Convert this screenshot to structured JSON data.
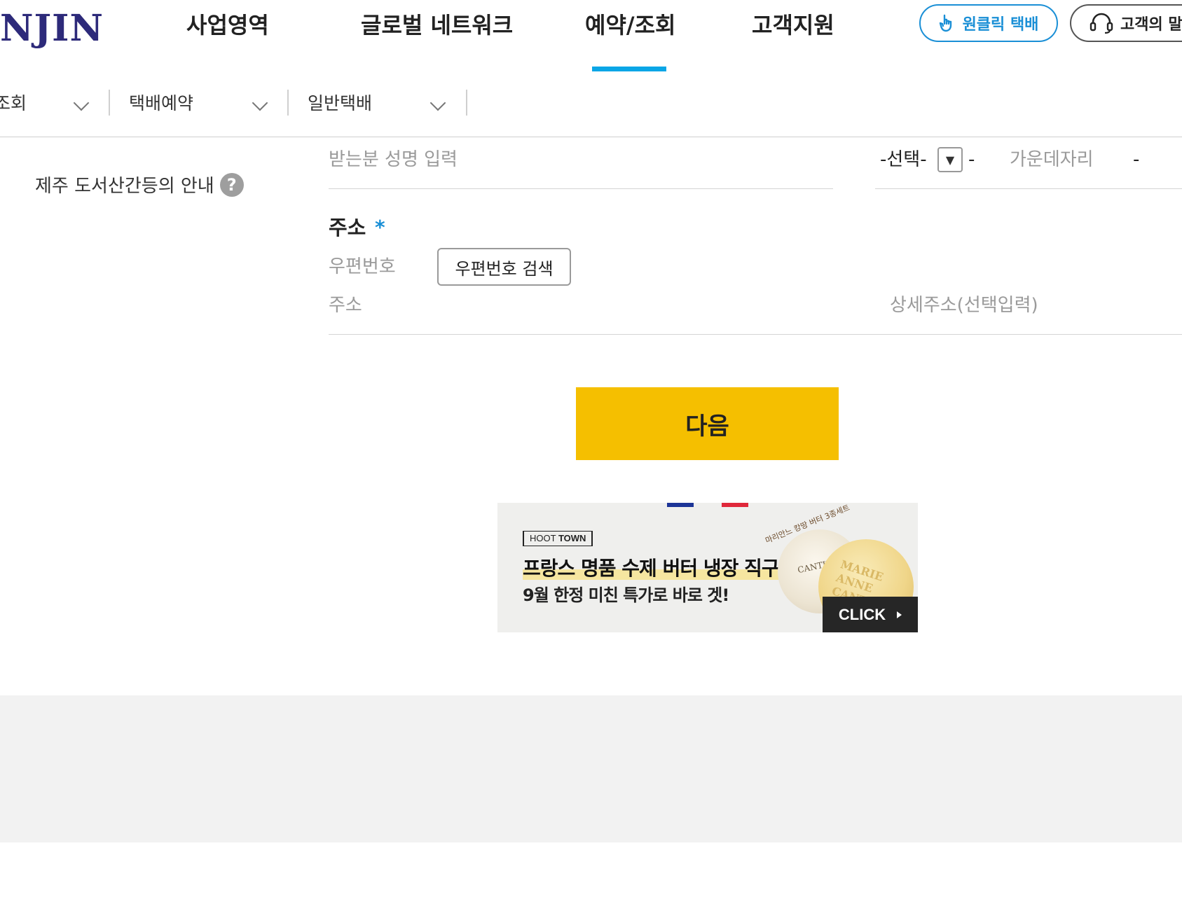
{
  "header": {
    "logo_text": "NJIN",
    "nav": [
      "사업영역",
      "글로벌 네트워크",
      "예약/조회",
      "고객지원"
    ],
    "oneclick_label": "원클릭 택배",
    "voice_label": "고객의 말"
  },
  "breadcrumb": {
    "items": [
      "조회",
      "택배예약",
      "일반택배"
    ]
  },
  "form": {
    "jeju_notice": "제주 도서산간등의 안내",
    "help_glyph": "?",
    "name_placeholder": "받는분 성명 입력",
    "phone_select": "-선택-",
    "phone_select_arrow": "▼",
    "phone_sep1": "-",
    "phone_middle_placeholder": "가운데자리",
    "phone_sep2": "-",
    "address_label": "주소",
    "required_mark": "*",
    "zip_label": "우편번호",
    "zip_search_button": "우편번호 검색",
    "address_placeholder": "주소",
    "detail_address_placeholder": "상세주소(선택입력)",
    "next_button": "다음"
  },
  "banner": {
    "brand_prefix": "HOOT",
    "brand_suffix": "TOWN",
    "headline": "프랑스 명품 수제 버터 냉장 직구",
    "subline": "9월 한정 미친 특가로 바로 겟!",
    "note": "마리안느 캉땅 버터 3종세트",
    "cheese_label": "CANTIN",
    "cheese_stamp_1": "MARIE",
    "cheese_stamp_2": "ANNE",
    "cheese_stamp_3": "CANTIN",
    "cta": "CLICK"
  }
}
